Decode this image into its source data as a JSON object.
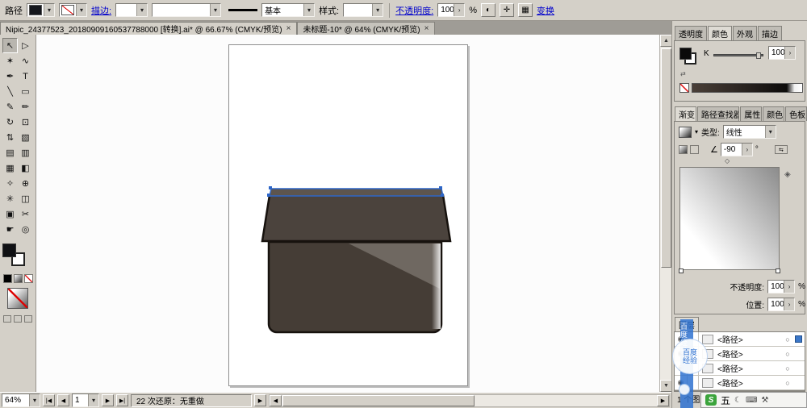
{
  "toolbar": {
    "context_label": "路径",
    "stroke_link": "描边:",
    "brush_value": "基本",
    "style_label": "样式:",
    "opacity_link": "不透明度:",
    "opacity_value": "100",
    "percent": "%",
    "transform_link": "变换"
  },
  "document_tabs": [
    {
      "title": "Nipic_24377523_20180909160537788000 [转换].ai* @ 66.67% (CMYK/预览)"
    },
    {
      "title": "未标题-10* @ 64% (CMYK/预览)"
    }
  ],
  "tools": [
    {
      "name": "selection-tool",
      "glyph": "↖"
    },
    {
      "name": "direct-selection-tool",
      "glyph": "▷"
    },
    {
      "name": "magic-wand-tool",
      "glyph": "✶"
    },
    {
      "name": "lasso-tool",
      "glyph": "∿"
    },
    {
      "name": "pen-tool",
      "glyph": "✒"
    },
    {
      "name": "type-tool",
      "glyph": "T"
    },
    {
      "name": "line-segment-tool",
      "glyph": "╲"
    },
    {
      "name": "rectangle-tool",
      "glyph": "▭"
    },
    {
      "name": "paintbrush-tool",
      "glyph": "✎"
    },
    {
      "name": "pencil-tool",
      "glyph": "✏"
    },
    {
      "name": "rotate-tool",
      "glyph": "↻"
    },
    {
      "name": "scale-tool",
      "glyph": "⊡"
    },
    {
      "name": "width-tool",
      "glyph": "⇅"
    },
    {
      "name": "free-transform-tool",
      "glyph": "▧"
    },
    {
      "name": "shape-builder-tool",
      "glyph": "▤"
    },
    {
      "name": "perspective-grid-tool",
      "glyph": "▥"
    },
    {
      "name": "mesh-tool",
      "glyph": "▦"
    },
    {
      "name": "gradient-tool",
      "glyph": "◧"
    },
    {
      "name": "eyedropper-tool",
      "glyph": "✧"
    },
    {
      "name": "blend-tool",
      "glyph": "⊕"
    },
    {
      "name": "symbol-sprayer-tool",
      "glyph": "✳"
    },
    {
      "name": "column-graph-tool",
      "glyph": "◫"
    },
    {
      "name": "artboard-tool",
      "glyph": "▣"
    },
    {
      "name": "slice-tool",
      "glyph": "✂"
    },
    {
      "name": "hand-tool",
      "glyph": "☛"
    },
    {
      "name": "zoom-tool",
      "glyph": "◎"
    }
  ],
  "dock": {
    "group1_tabs": [
      "透明度",
      "颜色",
      "外观",
      "描边"
    ],
    "color_panel": {
      "channel": "K",
      "value": "100"
    },
    "group2_tabs": [
      "渐变",
      "路径查找器",
      "属性",
      "颜色",
      "色板"
    ],
    "gradient": {
      "type_label": "类型:",
      "type_value": "线性",
      "angle_value": "-90",
      "degree": "°",
      "opacity_label": "不透明度:",
      "opacity_value": "100",
      "location_label": "位置:",
      "location_value": "100",
      "percent": "%"
    },
    "layers": {
      "tab_label": "图层",
      "rows": [
        {
          "label": "<路径>"
        },
        {
          "label": "<路径>"
        },
        {
          "label": "<路径>"
        },
        {
          "label": "<路径>"
        }
      ],
      "footer": "1 个图层"
    }
  },
  "status_bar": {
    "zoom": "64%",
    "artboard_number": "1",
    "undo_status": "22 次还原：无重做"
  },
  "watermark": {
    "line1": "百度",
    "line2": "经验"
  },
  "ime": {
    "badge": "S",
    "mode_char": "五"
  },
  "icons": {
    "dropdown": "▾",
    "spin": "›",
    "close": "×",
    "up": "▲",
    "down": "▼",
    "left": "◀",
    "right": "▶",
    "first": "|◀",
    "last": "▶|",
    "diamond": "◇",
    "eye": "◉",
    "target": "○",
    "angle": "∠",
    "reverse": "⇆",
    "droplet": "◈",
    "recolor": "◐",
    "grid": "▦",
    "swap": "⇄",
    "arrows": "✛",
    "new_folder": "❐",
    "new_layer": "❏",
    "trash": "✕",
    "moon": "☾",
    "keyboard": "⌨",
    "wrench": "⚒"
  },
  "artwork": {
    "lid_fill": "#4b433d",
    "lid_top_fill": "#5d554e",
    "body_fill": "#453d36",
    "highlight_fill": "#6f6861",
    "outline": "#17120e",
    "selection": "#2d66c8"
  }
}
